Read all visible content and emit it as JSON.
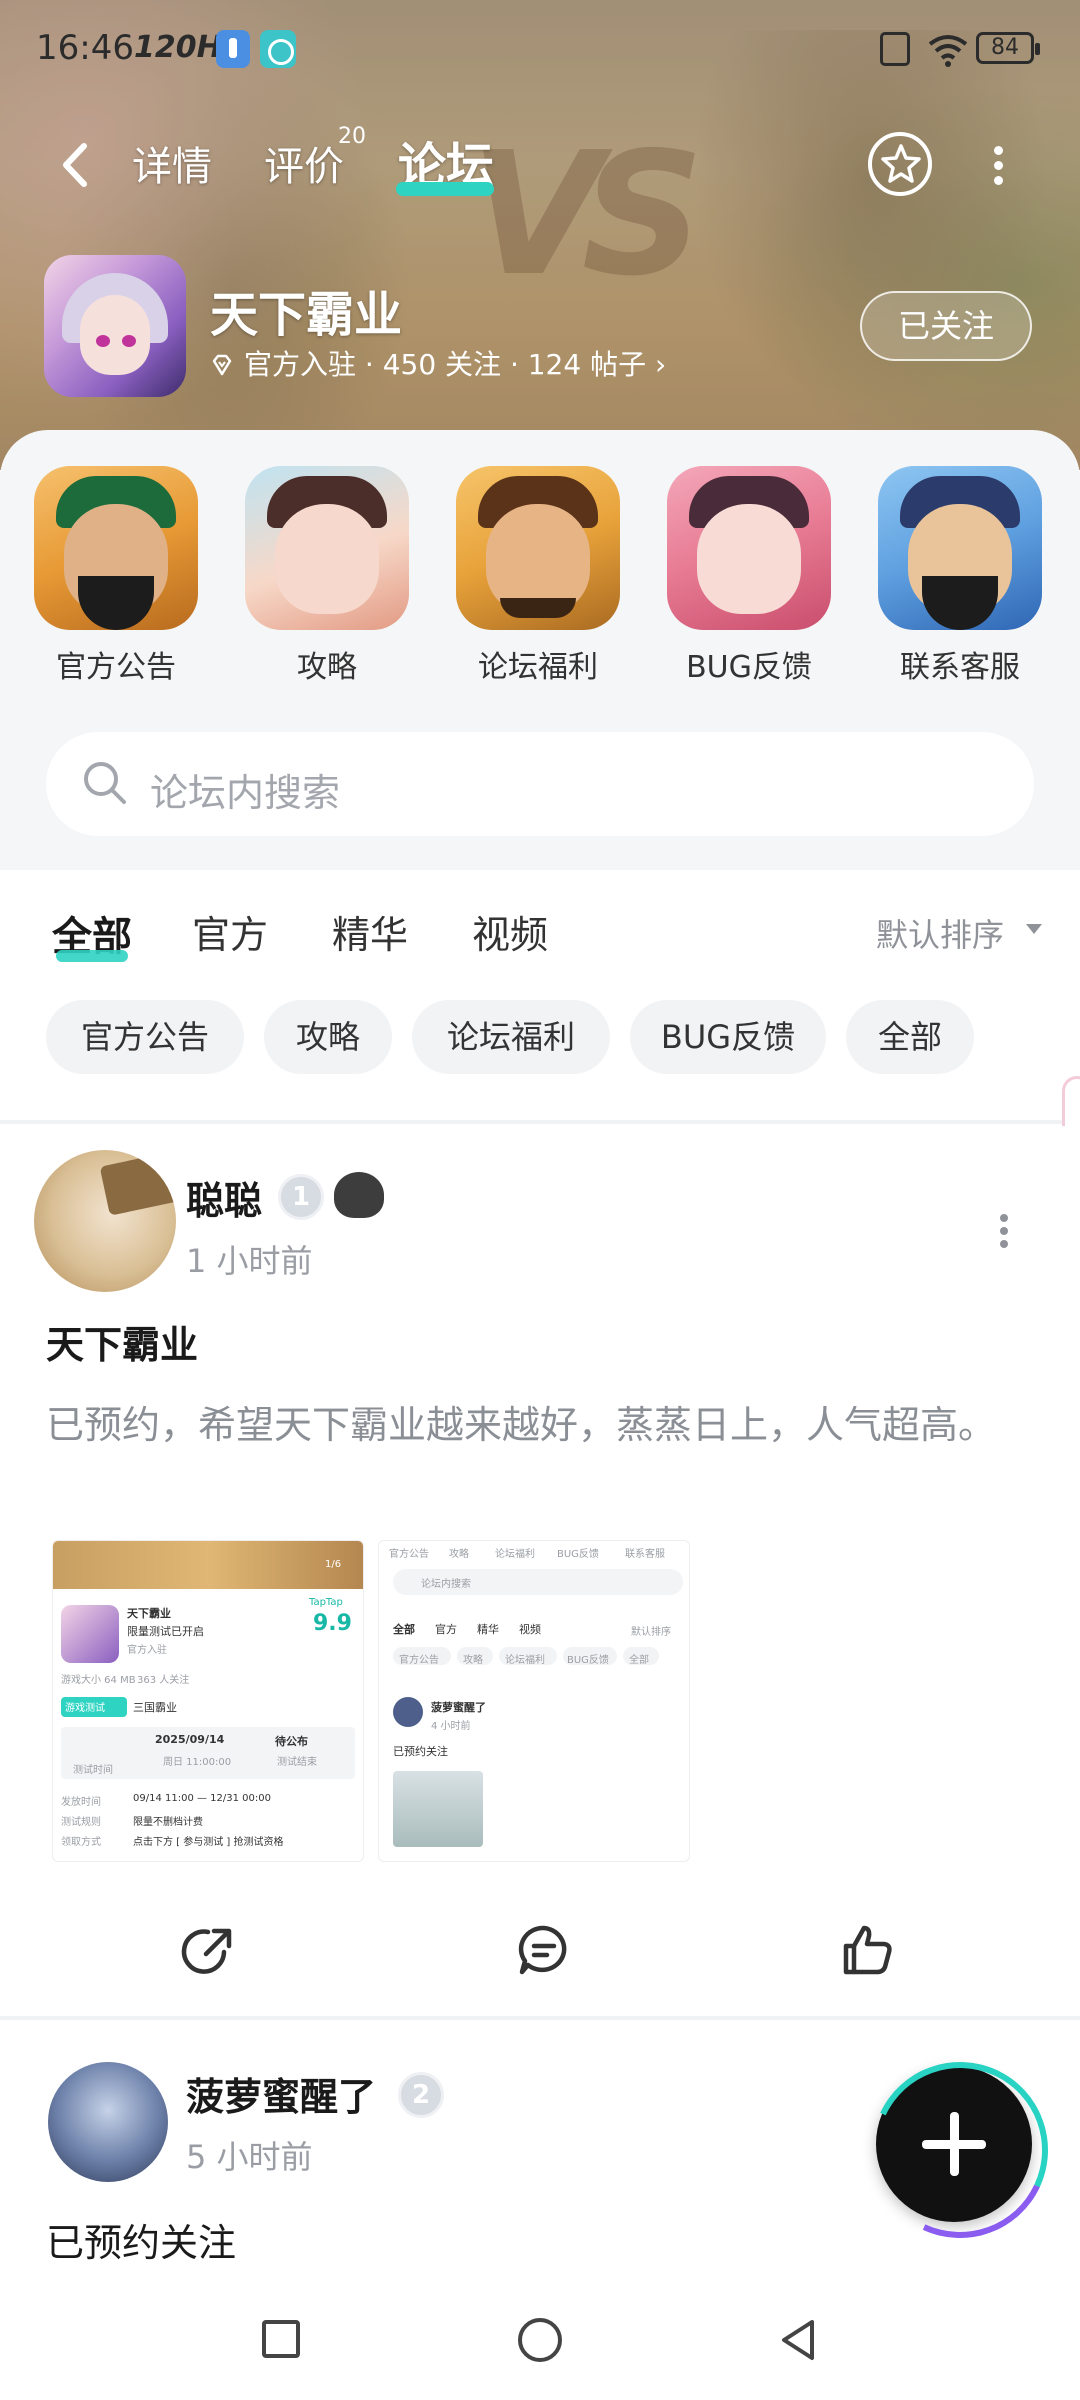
{
  "status_bar": {
    "time": "16:46",
    "refresh": "120Hz",
    "battery": "84"
  },
  "nav": {
    "tabs": [
      {
        "label": "详情"
      },
      {
        "label": "评价"
      },
      {
        "label": "论坛"
      }
    ],
    "review_count": "20",
    "active_tab": "论坛"
  },
  "game": {
    "title": "天下霸业",
    "meta": "官方入驻 · 450 关注 · 124 帖子 ›",
    "follow_label": "已关注"
  },
  "shortcuts": [
    {
      "label": "官方公告",
      "icon": "guan-yu-avatar"
    },
    {
      "label": "攻略",
      "icon": "diao-chan-avatar"
    },
    {
      "label": "论坛福利",
      "icon": "zhao-yun-avatar"
    },
    {
      "label": "BUG反馈",
      "icon": "maiden-avatar"
    },
    {
      "label": "联系客服",
      "icon": "zhang-fei-avatar"
    }
  ],
  "search": {
    "placeholder": "论坛内搜索"
  },
  "filters": {
    "tabs": [
      "全部",
      "官方",
      "精华",
      "视频"
    ],
    "active": "全部",
    "sort_label": "默认排序"
  },
  "chips": [
    "官方公告",
    "攻略",
    "论坛福利",
    "BUG反馈",
    "全部"
  ],
  "posts": [
    {
      "author": "聪聪",
      "level": "1",
      "time": "1 小时前",
      "title": "天下霸业",
      "body": "已预约，希望天下霸业越来越好，蒸蒸日上，人气超高。",
      "screenshots": {
        "left": {
          "game_title": "天下霸业",
          "subtitle": "限量测试已开启",
          "tag": "官方入驻",
          "size": "游戏大小 64 MB",
          "followers": "363 人关注",
          "section": "三国霸业",
          "test_badge": "游戏测试",
          "date": "2025/09/14",
          "day": "周日 11:00:00",
          "status": "待公布",
          "status_sub": "测试结束",
          "time_label": "测试时间",
          "rows": [
            {
              "k": "发放时间",
              "v": "09/14 11:00 — 12/31 00:00"
            },
            {
              "k": "测试规则",
              "v": "限量不删档计费"
            },
            {
              "k": "领取方式",
              "v": "点击下方 [ 参与测试 ] 抢测试资格"
            }
          ],
          "score_label": "TapTap",
          "score": "9.9",
          "pager": "1/6"
        },
        "right": {
          "tabs_row": [
            "官方公告",
            "攻略",
            "论坛福利",
            "BUG反馈",
            "联系客服"
          ],
          "search_placeholder": "论坛内搜索",
          "filters": [
            "全部",
            "官方",
            "精华",
            "视频"
          ],
          "sort": "默认排序",
          "chips": [
            "官方公告",
            "攻略",
            "论坛福利",
            "BUG反馈",
            "全部"
          ],
          "author": "菠萝蜜醒了",
          "time": "4 小时前",
          "body": "已预约关注"
        }
      }
    },
    {
      "author": "菠萝蜜醒了",
      "level": "2",
      "time": "5 小时前",
      "body": "已预约关注"
    }
  ]
}
